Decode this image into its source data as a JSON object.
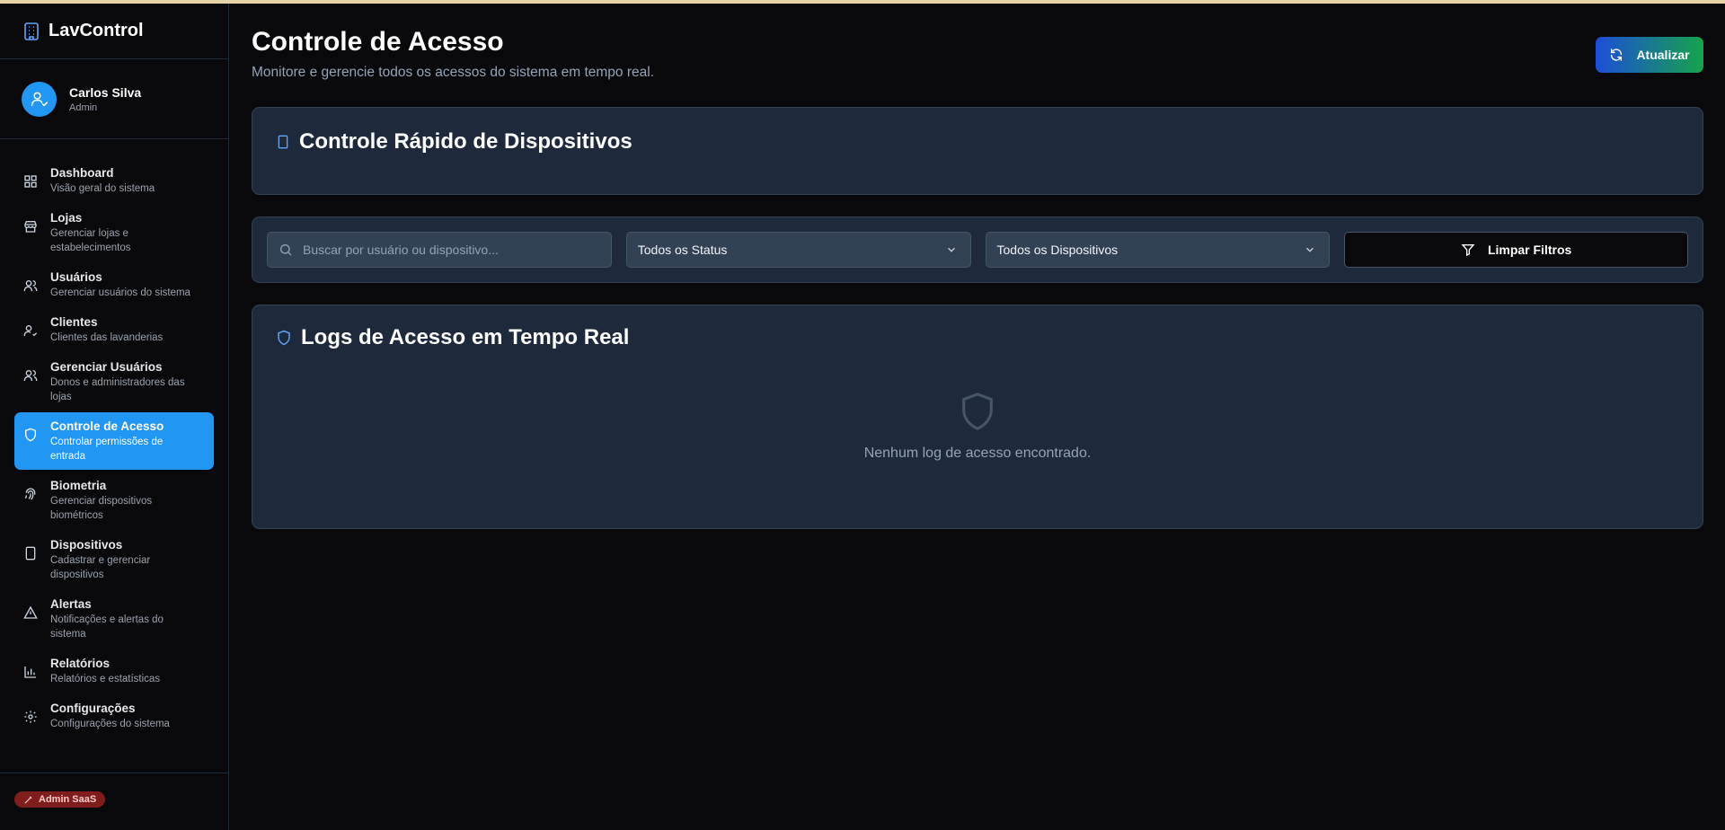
{
  "app": {
    "name": "LavControl"
  },
  "user": {
    "name": "Carlos Silva",
    "role": "Admin"
  },
  "sidebar": {
    "items": [
      {
        "label": "Dashboard",
        "sub": "Visão geral do sistema",
        "icon": "grid-icon"
      },
      {
        "label": "Lojas",
        "sub": "Gerenciar lojas e estabelecimentos",
        "icon": "store-icon"
      },
      {
        "label": "Usuários",
        "sub": "Gerenciar usuários do sistema",
        "icon": "users-icon"
      },
      {
        "label": "Clientes",
        "sub": "Clientes das lavanderias",
        "icon": "user-check-icon"
      },
      {
        "label": "Gerenciar Usuários",
        "sub": "Donos e administradores das lojas",
        "icon": "users-icon"
      },
      {
        "label": "Controle de Acesso",
        "sub": "Controlar permissões de entrada",
        "icon": "shield-icon",
        "active": true
      },
      {
        "label": "Biometria",
        "sub": "Gerenciar dispositivos biométricos",
        "icon": "fingerprint-icon"
      },
      {
        "label": "Dispositivos",
        "sub": "Cadastrar e gerenciar dispositivos",
        "icon": "tablet-icon"
      },
      {
        "label": "Alertas",
        "sub": "Notificações e alertas do sistema",
        "icon": "alert-triangle-icon"
      },
      {
        "label": "Relatórios",
        "sub": "Relatórios e estatísticas",
        "icon": "bar-chart-icon"
      },
      {
        "label": "Configurações",
        "sub": "Configurações do sistema",
        "icon": "gear-icon"
      }
    ],
    "footer_badge": "Admin SaaS"
  },
  "header": {
    "title": "Controle de Acesso",
    "subtitle": "Monitore e gerencie todos os acessos do sistema em tempo real.",
    "refresh_label": "Atualizar"
  },
  "quick_control": {
    "title": "Controle Rápido de Dispositivos"
  },
  "filters": {
    "search_placeholder": "Buscar por usuário ou dispositivo...",
    "search_value": "",
    "status_selected": "Todos os Status",
    "device_selected": "Todos os Dispositivos",
    "clear_label": "Limpar Filtros"
  },
  "logs": {
    "title": "Logs de Acesso em Tempo Real",
    "empty_text": "Nenhum log de acesso encontrado."
  },
  "colors": {
    "accent": "#2196f3",
    "card_bg": "#1e293b",
    "page_bg": "#09090b",
    "badge_red": "#7f1d1d"
  }
}
